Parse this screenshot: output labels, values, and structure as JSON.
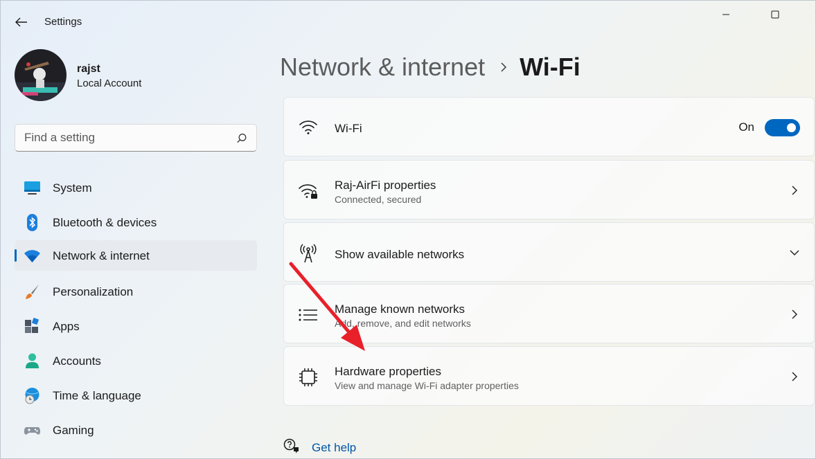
{
  "window": {
    "title": "Settings"
  },
  "profile": {
    "name": "rajst",
    "account_type": "Local Account"
  },
  "search": {
    "placeholder": "Find a setting"
  },
  "nav": {
    "items": [
      {
        "label": "System",
        "icon": "system-icon"
      },
      {
        "label": "Bluetooth & devices",
        "icon": "bluetooth-icon"
      },
      {
        "label": "Network & internet",
        "icon": "wifi-icon",
        "selected": true
      },
      {
        "label": "Personalization",
        "icon": "brush-icon"
      },
      {
        "label": "Apps",
        "icon": "apps-icon"
      },
      {
        "label": "Accounts",
        "icon": "person-icon"
      },
      {
        "label": "Time & language",
        "icon": "globe-clock-icon"
      },
      {
        "label": "Gaming",
        "icon": "gamepad-icon"
      }
    ]
  },
  "header": {
    "parent": "Network & internet",
    "current": "Wi-Fi"
  },
  "cards": {
    "wifi": {
      "title": "Wi-Fi",
      "toggle_label": "On",
      "toggle_on": true
    },
    "properties": {
      "title": "Raj-AirFi properties",
      "subtitle": "Connected, secured"
    },
    "available": {
      "title": "Show available networks"
    },
    "known": {
      "title": "Manage known networks",
      "subtitle": "Add, remove, and edit networks"
    },
    "hardware": {
      "title": "Hardware properties",
      "subtitle": "View and manage Wi-Fi adapter properties"
    }
  },
  "help": {
    "label": "Get help"
  },
  "colors": {
    "accent": "#0067c0",
    "annotation_arrow": "#e8202a",
    "link": "#0056a8"
  }
}
